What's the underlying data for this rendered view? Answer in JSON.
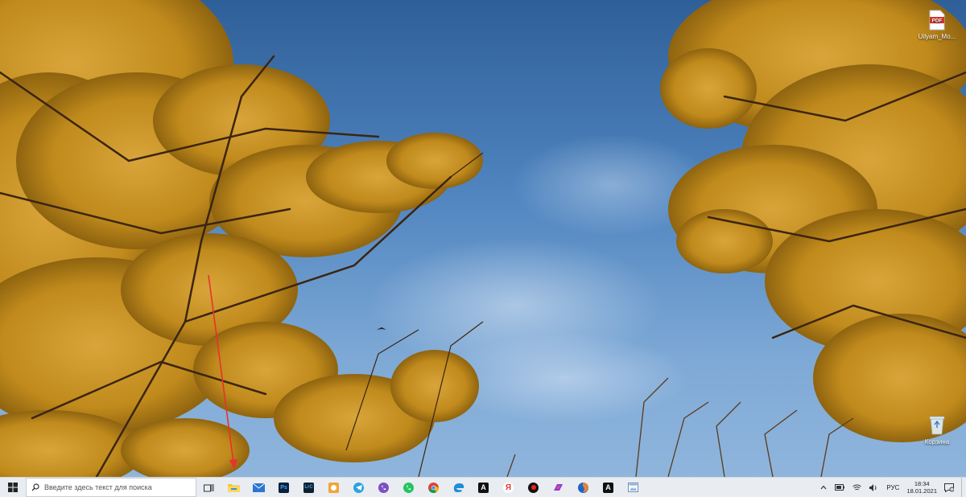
{
  "desktop": {
    "icons": [
      {
        "label": "Uilyam_Mo...",
        "icon": "pdf-file-icon",
        "badge": "PDF"
      },
      {
        "label": "Корзина",
        "icon": "recycle-bin-icon"
      }
    ]
  },
  "taskbar": {
    "search_placeholder": "Введите здесь текст для поиска",
    "apps": [
      {
        "name": "task-view",
        "icon": "task-view-icon"
      },
      {
        "name": "file-explorer",
        "icon": "folder-icon",
        "highlighted": true
      },
      {
        "name": "mail",
        "icon": "mail-icon"
      },
      {
        "name": "photoshop",
        "icon": "photoshop-icon",
        "label": "Ps"
      },
      {
        "name": "lightroom-classic",
        "icon": "lightroom-icon",
        "label": "LrC"
      },
      {
        "name": "media-app",
        "icon": "orange-app-icon"
      },
      {
        "name": "telegram",
        "icon": "telegram-icon"
      },
      {
        "name": "viber",
        "icon": "viber-icon"
      },
      {
        "name": "whatsapp",
        "icon": "whatsapp-icon"
      },
      {
        "name": "chrome",
        "icon": "chrome-icon"
      },
      {
        "name": "edge",
        "icon": "edge-icon"
      },
      {
        "name": "app-a-1",
        "icon": "letter-a-icon",
        "label": "A"
      },
      {
        "name": "yandex",
        "icon": "yandex-icon",
        "label": "Я"
      },
      {
        "name": "recorder",
        "icon": "record-icon"
      },
      {
        "name": "php-app",
        "icon": "php-icon"
      },
      {
        "name": "firefox",
        "icon": "firefox-icon"
      },
      {
        "name": "app-a-2",
        "icon": "letter-a-icon",
        "label": "A"
      },
      {
        "name": "image-viewer",
        "icon": "photos-icon"
      }
    ],
    "tray": {
      "language": "РУС",
      "time": "18:34",
      "date": "18.01.2021"
    }
  },
  "colors": {
    "taskbar_bg": "#e9edf1",
    "annotation_red": "#e8322d",
    "sky": "#4f84bf",
    "foliage": "#c9921f"
  }
}
